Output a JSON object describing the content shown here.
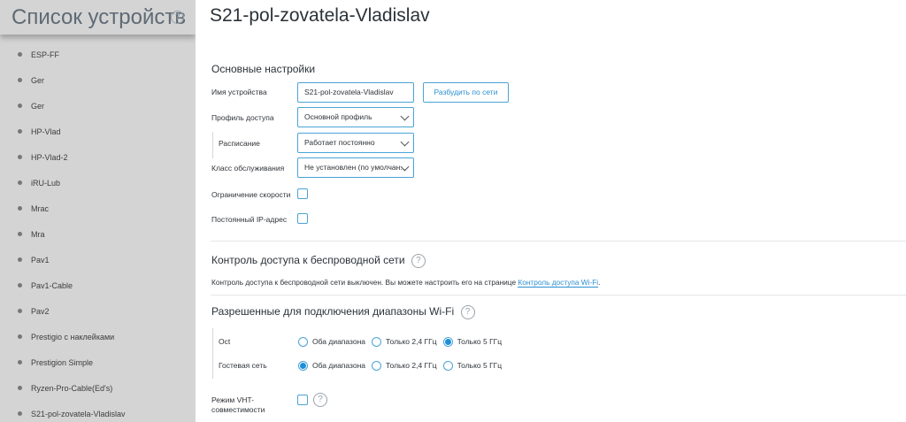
{
  "sidebar": {
    "title": "Список устройств",
    "help_glyph": "?",
    "devices": [
      "ESP-FF",
      "Ger",
      "Ger",
      "HP-Vlad",
      "HP-Vlad-2",
      "iRU-Lub",
      "Mrac",
      "Mra",
      "Pav1",
      "Pav1-Cable",
      "Pav2",
      "Prestigio с наклейками",
      "Prestigion Simple",
      "Ryzen-Pro-Cable(Ed's)",
      "S21-pol-zovatela-Vladislav"
    ]
  },
  "main": {
    "title": "S21-pol-zovatela-Vladislav",
    "basic": {
      "title": "Основные настройки",
      "device_name_label": "Имя устройства",
      "device_name_value": "S21-pol-zovatela-Vladislav",
      "unbind_button": "Разбудить по сети",
      "profile_label": "Профиль доступа",
      "profile_value": "Основной профиль",
      "schedule_label": "Расписание",
      "schedule_value": "Работает постоянно",
      "class_label": "Класс обслуживания",
      "class_value": "Не установлен (по умолчан...",
      "speed_limit_label": "Ограничение скорости",
      "static_ip_label": "Постоянный IP-адрес"
    },
    "wireless_access": {
      "title": "Контроль доступа к беспроводной сети",
      "text": "Контроль доступа к беспроводной сети выключен. Вы можете настроить его на странице",
      "link": "Контроль доступа Wi-Fi",
      "text_end": "."
    },
    "wifi_ranges": {
      "title": "Разрешенные для подключения диапазоны Wi-Fi",
      "rows": [
        {
          "label": "Oct",
          "options": [
            "Оба диапазона",
            "Только 2,4 ГГц",
            "Только 5 ГГц"
          ],
          "selected": 2
        },
        {
          "label": "Гостевая сеть",
          "options": [
            "Оба диапазона",
            "Только 2,4 ГГц",
            "Только 5 ГГц"
          ],
          "selected": 0
        }
      ]
    },
    "vht": {
      "label_line1": "Режим VHT-",
      "label_line2": "совместимости"
    }
  },
  "colors": {
    "sidebar_bg": "#d4d4d4",
    "accent": "#1e8fd6",
    "border_accent": "#4aa3d6",
    "link": "#2a8fd0"
  },
  "icons": {
    "help": "question-circle-icon",
    "chevron": "chevron-down-icon",
    "bullet": "dot-icon"
  }
}
